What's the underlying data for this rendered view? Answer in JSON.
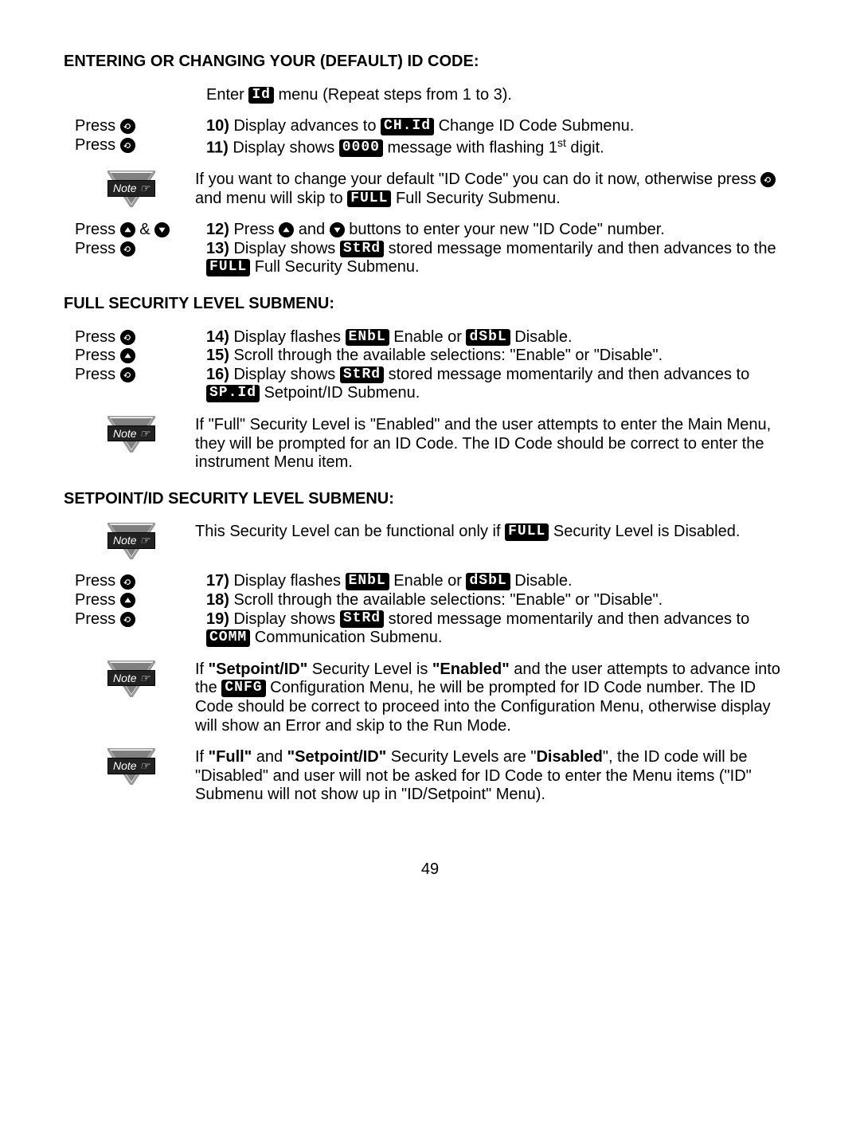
{
  "page_number": "49",
  "icons": {
    "menu": "menu-button-icon",
    "up": "up-button-icon",
    "down": "down-button-icon"
  },
  "lcd": {
    "id": "Id",
    "ch_id": "CH.Id",
    "zeros": "0000",
    "full": "FULL",
    "strd": "StRd",
    "enbl": "ENbL",
    "dsbl": "dSbL",
    "sp_id": "SP.Id",
    "comm": "COMM",
    "cnfg": "CNFG"
  },
  "heading1": "ENTERING OR CHANGING YOUR (DEFAULT) ID CODE:",
  "intro_a": "Enter ",
  "intro_b": " menu (Repeat steps from 1 to 3).",
  "press": "Press ",
  "amp": " & ",
  "s10_a": " Display advances to ",
  "s10_b": " Change ID Code Submenu.",
  "s11_a": " Display shows ",
  "s11_b": " message with flashing 1",
  "s11_c": " digit.",
  "note1_a": "If you want to change your default \"ID Code\" you can do it now, otherwise press ",
  "note1_b": " and menu will skip to ",
  "note1_c": " Full Security Submenu.",
  "s12_a": " Press ",
  "s12_b": " and ",
  "s12_c": " buttons to enter your new \"ID Code\" number.",
  "s13_a": " Display shows ",
  "s13_b": " stored message momentarily and then advances to the ",
  "s13_c": " Full Security Submenu.",
  "heading2": "FULL SECURITY LEVEL SUBMENU:",
  "s14_a": " Display flashes ",
  "s14_b": " Enable or ",
  "s14_c": " Disable.",
  "s15": " Scroll through the available selections: \"Enable\" or \"Disable\".",
  "s16_a": " Display shows ",
  "s16_b": " stored message momentarily and then advances to ",
  "s16_c": " Setpoint/ID Submenu.",
  "note2": "If \"Full\" Security Level is \"Enabled\" and the user attempts to enter the Main Menu, they will be prompted for an ID Code. The ID Code should be correct to enter the instrument Menu item.",
  "heading3": "SETPOINT/ID SECURITY LEVEL SUBMENU:",
  "note3_a": "This Security Level can be functional only if ",
  "note3_b": " Security Level is Disabled.",
  "s17_a": " Display flashes ",
  "s17_b": " Enable or ",
  "s17_c": " Disable.",
  "s18": " Scroll through the available selections: \"Enable\" or \"Disable\".",
  "s19_a": " Display shows ",
  "s19_b": " stored message momentarily and then advances to ",
  "s19_c": " Communication Submenu.",
  "note4_a": "If ",
  "note4_b": "\"Setpoint/ID\"",
  "note4_c": " Security Level is ",
  "note4_d": "\"Enabled\"",
  "note4_e": " and the user attempts to advance into the ",
  "note4_f": " Configuration Menu, he will be prompted for ID Code number. The ID Code should be correct to proceed into the Configuration Menu, otherwise display will show an Error and skip to the Run Mode.",
  "note5_a": "If ",
  "note5_b": "\"Full\"",
  "note5_c": " and ",
  "note5_d": "\"Setpoint/ID\"",
  "note5_e": " Security Levels are \"",
  "note5_f": "Disabled",
  "note5_g": "\", the ID code will be \"Disabled\" and user will not be asked for ID Code to enter the Menu items (\"ID\" Submenu will not show up in \"ID/Setpoint\" Menu).",
  "note_label": "Note ☞",
  "n10": "10)",
  "n11": "11)",
  "n12": "12)",
  "n13": "13)",
  "n14": "14)",
  "n15": "15)",
  "n16": "16)",
  "n17": "17)",
  "n18": "18)",
  "n19": "19)",
  "st": "st"
}
